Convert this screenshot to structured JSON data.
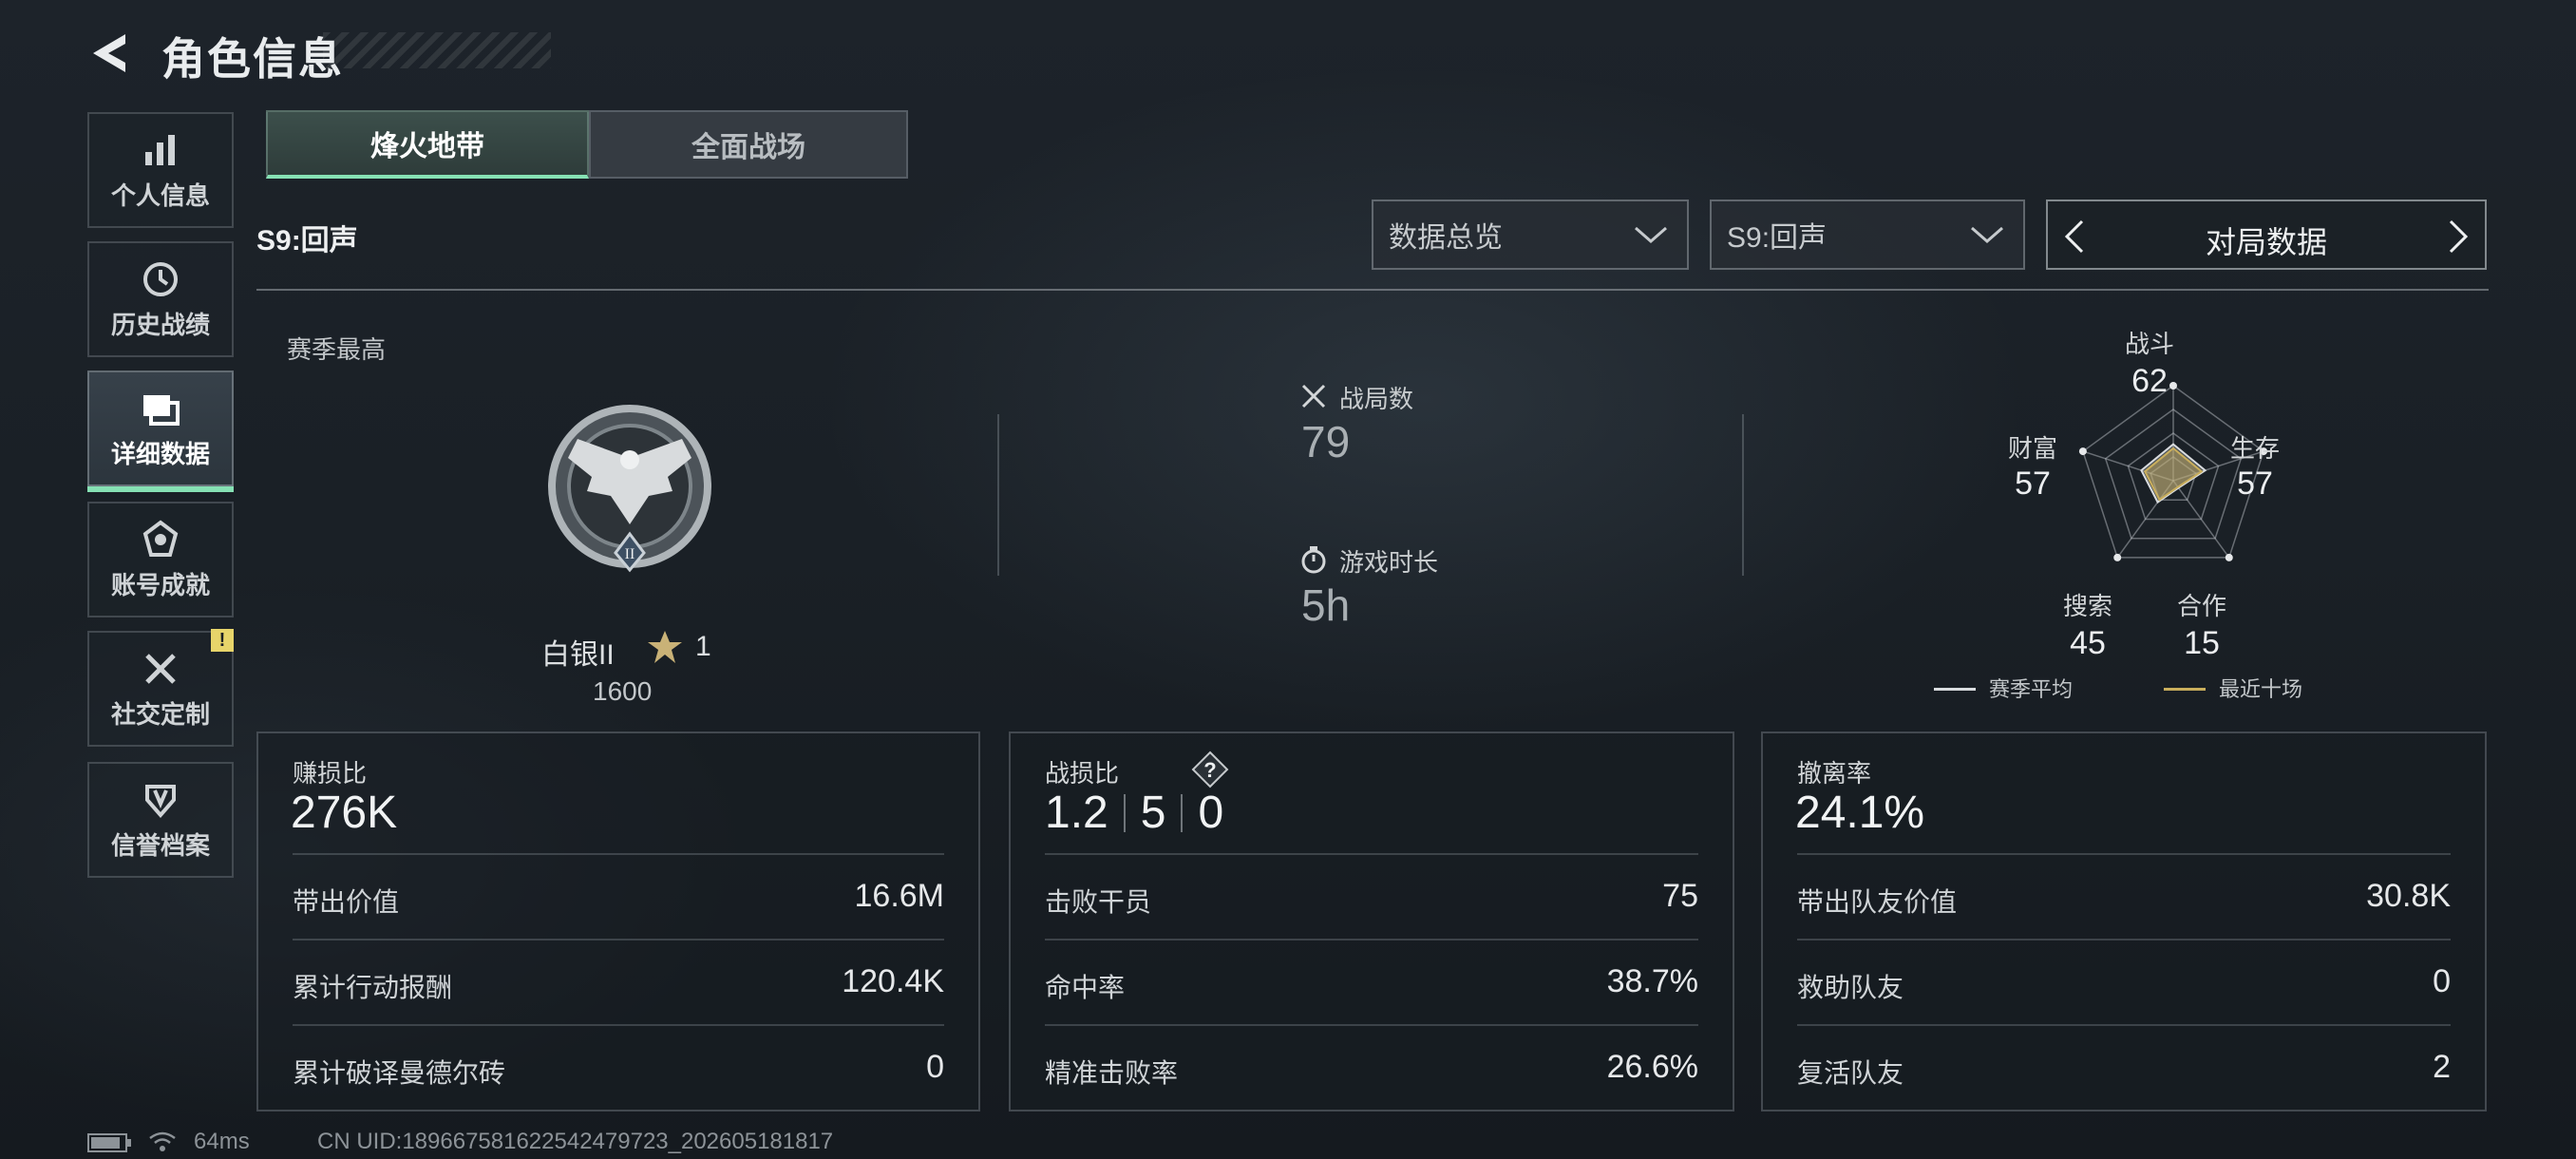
{
  "header": {
    "title": "角色信息"
  },
  "sidebar": {
    "items": [
      {
        "label": "个人信息"
      },
      {
        "label": "历史战绩"
      },
      {
        "label": "详细数据"
      },
      {
        "label": "账号成就"
      },
      {
        "label": "社交定制",
        "badge": "!"
      },
      {
        "label": "信誉档案"
      }
    ]
  },
  "mode_tabs": [
    {
      "label": "烽火地带",
      "active": true
    },
    {
      "label": "全面战场",
      "active": false
    }
  ],
  "season_label": "S9:回声",
  "filters": {
    "view": "数据总览",
    "season": "S9:回声",
    "data_type": "对局数据"
  },
  "season_best": {
    "label": "赛季最高",
    "rank_name": "白银II",
    "stars": "1",
    "score": "1600"
  },
  "match_stats": {
    "matches_label": "战局数",
    "matches_value": "79",
    "playtime_label": "游戏时长",
    "playtime_value": "5h"
  },
  "radar": {
    "axes": [
      {
        "label": "战斗",
        "value": "62"
      },
      {
        "label": "生存",
        "value": "57"
      },
      {
        "label": "合作",
        "value": "15"
      },
      {
        "label": "搜索",
        "value": "45"
      },
      {
        "label": "财富",
        "value": "57"
      }
    ],
    "legend": [
      {
        "label": "赛季平均",
        "color": "#d9dcdf"
      },
      {
        "label": "最近十场",
        "color": "#c9ae5c"
      }
    ]
  },
  "panels": {
    "profit": {
      "label": "赚损比",
      "value": "276K",
      "rows": [
        {
          "k": "带出价值",
          "v": "16.6M"
        },
        {
          "k": "累计行动报酬",
          "v": "120.4K"
        },
        {
          "k": "累计破译曼德尔砖",
          "v": "0"
        }
      ]
    },
    "combat": {
      "label": "战损比",
      "kd": [
        "1.2",
        "5",
        "0"
      ],
      "rows": [
        {
          "k": "击败干员",
          "v": "75"
        },
        {
          "k": "命中率",
          "v": "38.7%"
        },
        {
          "k": "精准击败率",
          "v": "26.6%"
        }
      ]
    },
    "extract": {
      "label": "撤离率",
      "value": "24.1%",
      "rows": [
        {
          "k": "带出队友价值",
          "v": "30.8K"
        },
        {
          "k": "救助队友",
          "v": "0"
        },
        {
          "k": "复活队友",
          "v": "2"
        }
      ]
    }
  },
  "footer": {
    "ping": "64ms",
    "uid": "CN UID:18966758162254247972​3_202605181817"
  }
}
